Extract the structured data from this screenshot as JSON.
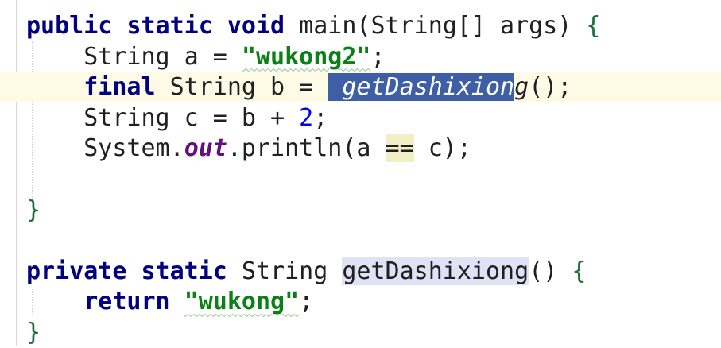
{
  "editor": {
    "language": "java",
    "lines": [
      {
        "tokens": [
          {
            "t": "public",
            "c": "kw"
          },
          {
            "t": " "
          },
          {
            "t": "static",
            "c": "kw"
          },
          {
            "t": " "
          },
          {
            "t": "void",
            "c": "kw"
          },
          {
            "t": " main(String[] args) "
          },
          {
            "t": "{",
            "c": "brace"
          }
        ]
      },
      {
        "tokens": [
          {
            "t": "    String a = "
          },
          {
            "t": "\"wukong2\"",
            "c": "str squiggle"
          },
          {
            "t": ";"
          }
        ]
      },
      {
        "current": true,
        "tokens": [
          {
            "t": "    "
          },
          {
            "t": "final",
            "c": "kw"
          },
          {
            "t": " String b = "
          },
          {
            "t": " getDashixion",
            "c": "sel"
          },
          {
            "t": "g",
            "c": "ital"
          },
          {
            "t": "();"
          }
        ]
      },
      {
        "tokens": [
          {
            "t": "    String c = b + "
          },
          {
            "t": "2",
            "c": "num"
          },
          {
            "t": ";"
          }
        ]
      },
      {
        "tokens": [
          {
            "t": "    System."
          },
          {
            "t": "out",
            "c": "field"
          },
          {
            "t": ".println(a "
          },
          {
            "t": "==",
            "c": "usage-highlight"
          },
          {
            "t": " c);"
          }
        ]
      },
      {
        "tokens": []
      },
      {
        "tokens": [
          {
            "t": "}",
            "c": "brace"
          }
        ]
      },
      {
        "tokens": []
      },
      {
        "tokens": [
          {
            "t": "private",
            "c": "kw"
          },
          {
            "t": " "
          },
          {
            "t": "static",
            "c": "kw"
          },
          {
            "t": " String "
          },
          {
            "t": "getDashixiong",
            "c": "decl-highlight"
          },
          {
            "t": "() "
          },
          {
            "t": "{",
            "c": "brace"
          }
        ]
      },
      {
        "tokens": [
          {
            "t": "    "
          },
          {
            "t": "return",
            "c": "kw"
          },
          {
            "t": " "
          },
          {
            "t": "\"wukong\"",
            "c": "str squiggle"
          },
          {
            "t": ";"
          }
        ]
      },
      {
        "tokens": [
          {
            "t": "}",
            "c": "brace"
          }
        ]
      }
    ]
  }
}
